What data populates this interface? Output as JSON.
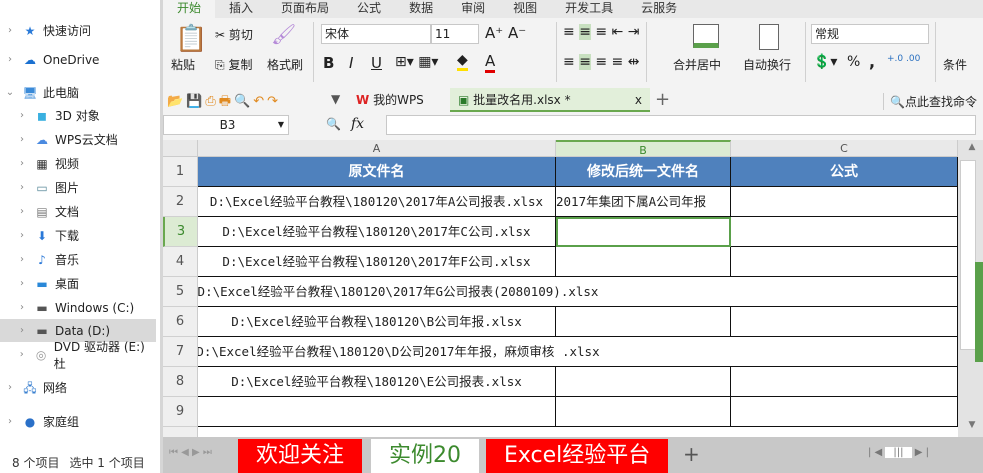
{
  "explorer": {
    "items": [
      {
        "label": "快速访问",
        "icon": "star-icon",
        "level": 0
      },
      {
        "label": "OneDrive",
        "icon": "cloud-icon",
        "level": 0
      },
      {
        "label": "此电脑",
        "icon": "computer-icon",
        "level": 0,
        "expanded": true
      },
      {
        "label": "3D 对象",
        "icon": "cube-icon",
        "level": 1
      },
      {
        "label": "WPS云文档",
        "icon": "cloud-outline-icon",
        "level": 1
      },
      {
        "label": "视频",
        "icon": "film-icon",
        "level": 1
      },
      {
        "label": "图片",
        "icon": "picture-icon",
        "level": 1
      },
      {
        "label": "文档",
        "icon": "document-icon",
        "level": 1
      },
      {
        "label": "下载",
        "icon": "download-icon",
        "level": 1
      },
      {
        "label": "音乐",
        "icon": "music-icon",
        "level": 1
      },
      {
        "label": "桌面",
        "icon": "desktop-icon",
        "level": 1
      },
      {
        "label": "Windows (C:)",
        "icon": "drive-icon",
        "level": 1
      },
      {
        "label": "Data (D:)",
        "icon": "drive-icon",
        "level": 1,
        "selected": true
      },
      {
        "label": "DVD 驱动器 (E:) 杜",
        "icon": "disc-icon",
        "level": 1
      },
      {
        "label": "网络",
        "icon": "network-icon",
        "level": 0
      },
      {
        "label": "家庭组",
        "icon": "homegroup-icon",
        "level": 0
      }
    ],
    "status_count": "8 个项目",
    "status_selected": "选中 1 个项目"
  },
  "menu": {
    "tabs": [
      "开始",
      "插入",
      "页面布局",
      "公式",
      "数据",
      "审阅",
      "视图",
      "开发工具",
      "云服务"
    ],
    "active": 0
  },
  "ribbon": {
    "paste": "粘贴",
    "cut": "剪切",
    "copy": "复制",
    "format_painter": "格式刷",
    "font": "宋体",
    "size": "11",
    "bold": "B",
    "italic": "I",
    "underline": "U",
    "merge": "合并居中",
    "wrap": "自动换行",
    "number_format": "常规",
    "percent": "%",
    "comma": ",",
    "conditional": "条件"
  },
  "doctabs": {
    "home": "我的WPS",
    "file": "批量改名用.xlsx *",
    "search": "点此查找命令"
  },
  "formula": {
    "name_box": "B3",
    "fx": "fx",
    "value": ""
  },
  "sheet": {
    "columns": [
      "A",
      "B",
      "C"
    ],
    "rows": [
      "1",
      "2",
      "3",
      "4",
      "5",
      "6",
      "7",
      "8",
      "9"
    ],
    "headers": [
      "原文件名",
      "修改后统一文件名",
      "公式"
    ],
    "data": [
      [
        "D:\\Excel经验平台教程\\180120\\2017年A公司报表.xlsx",
        "2017年集团下属A公司年报",
        ""
      ],
      [
        "D:\\Excel经验平台教程\\180120\\2017年C公司.xlsx",
        "",
        ""
      ],
      [
        "D:\\Excel经验平台教程\\180120\\2017年F公司.xlsx",
        "",
        ""
      ],
      [
        "D:\\Excel经验平台教程\\180120\\2017年G公司报表(2080109).xlsx",
        "",
        ""
      ],
      [
        "D:\\Excel经验平台教程\\180120\\B公司年报.xlsx",
        "",
        ""
      ],
      [
        "D:\\Excel经验平台教程\\180120\\D公司2017年年报，麻烦审核 .xlsx",
        "",
        ""
      ],
      [
        "D:\\Excel经验平台教程\\180120\\E公司报表.xlsx",
        "",
        ""
      ],
      [
        "",
        "",
        ""
      ]
    ],
    "selected": "B3"
  },
  "sheet_tabs": [
    "欢迎关注",
    "实例20",
    "Excel经验平台"
  ],
  "colors": {
    "accent": "#3c8a2e",
    "header_fill": "#4f81bd",
    "tab_red": "#ff0000"
  }
}
